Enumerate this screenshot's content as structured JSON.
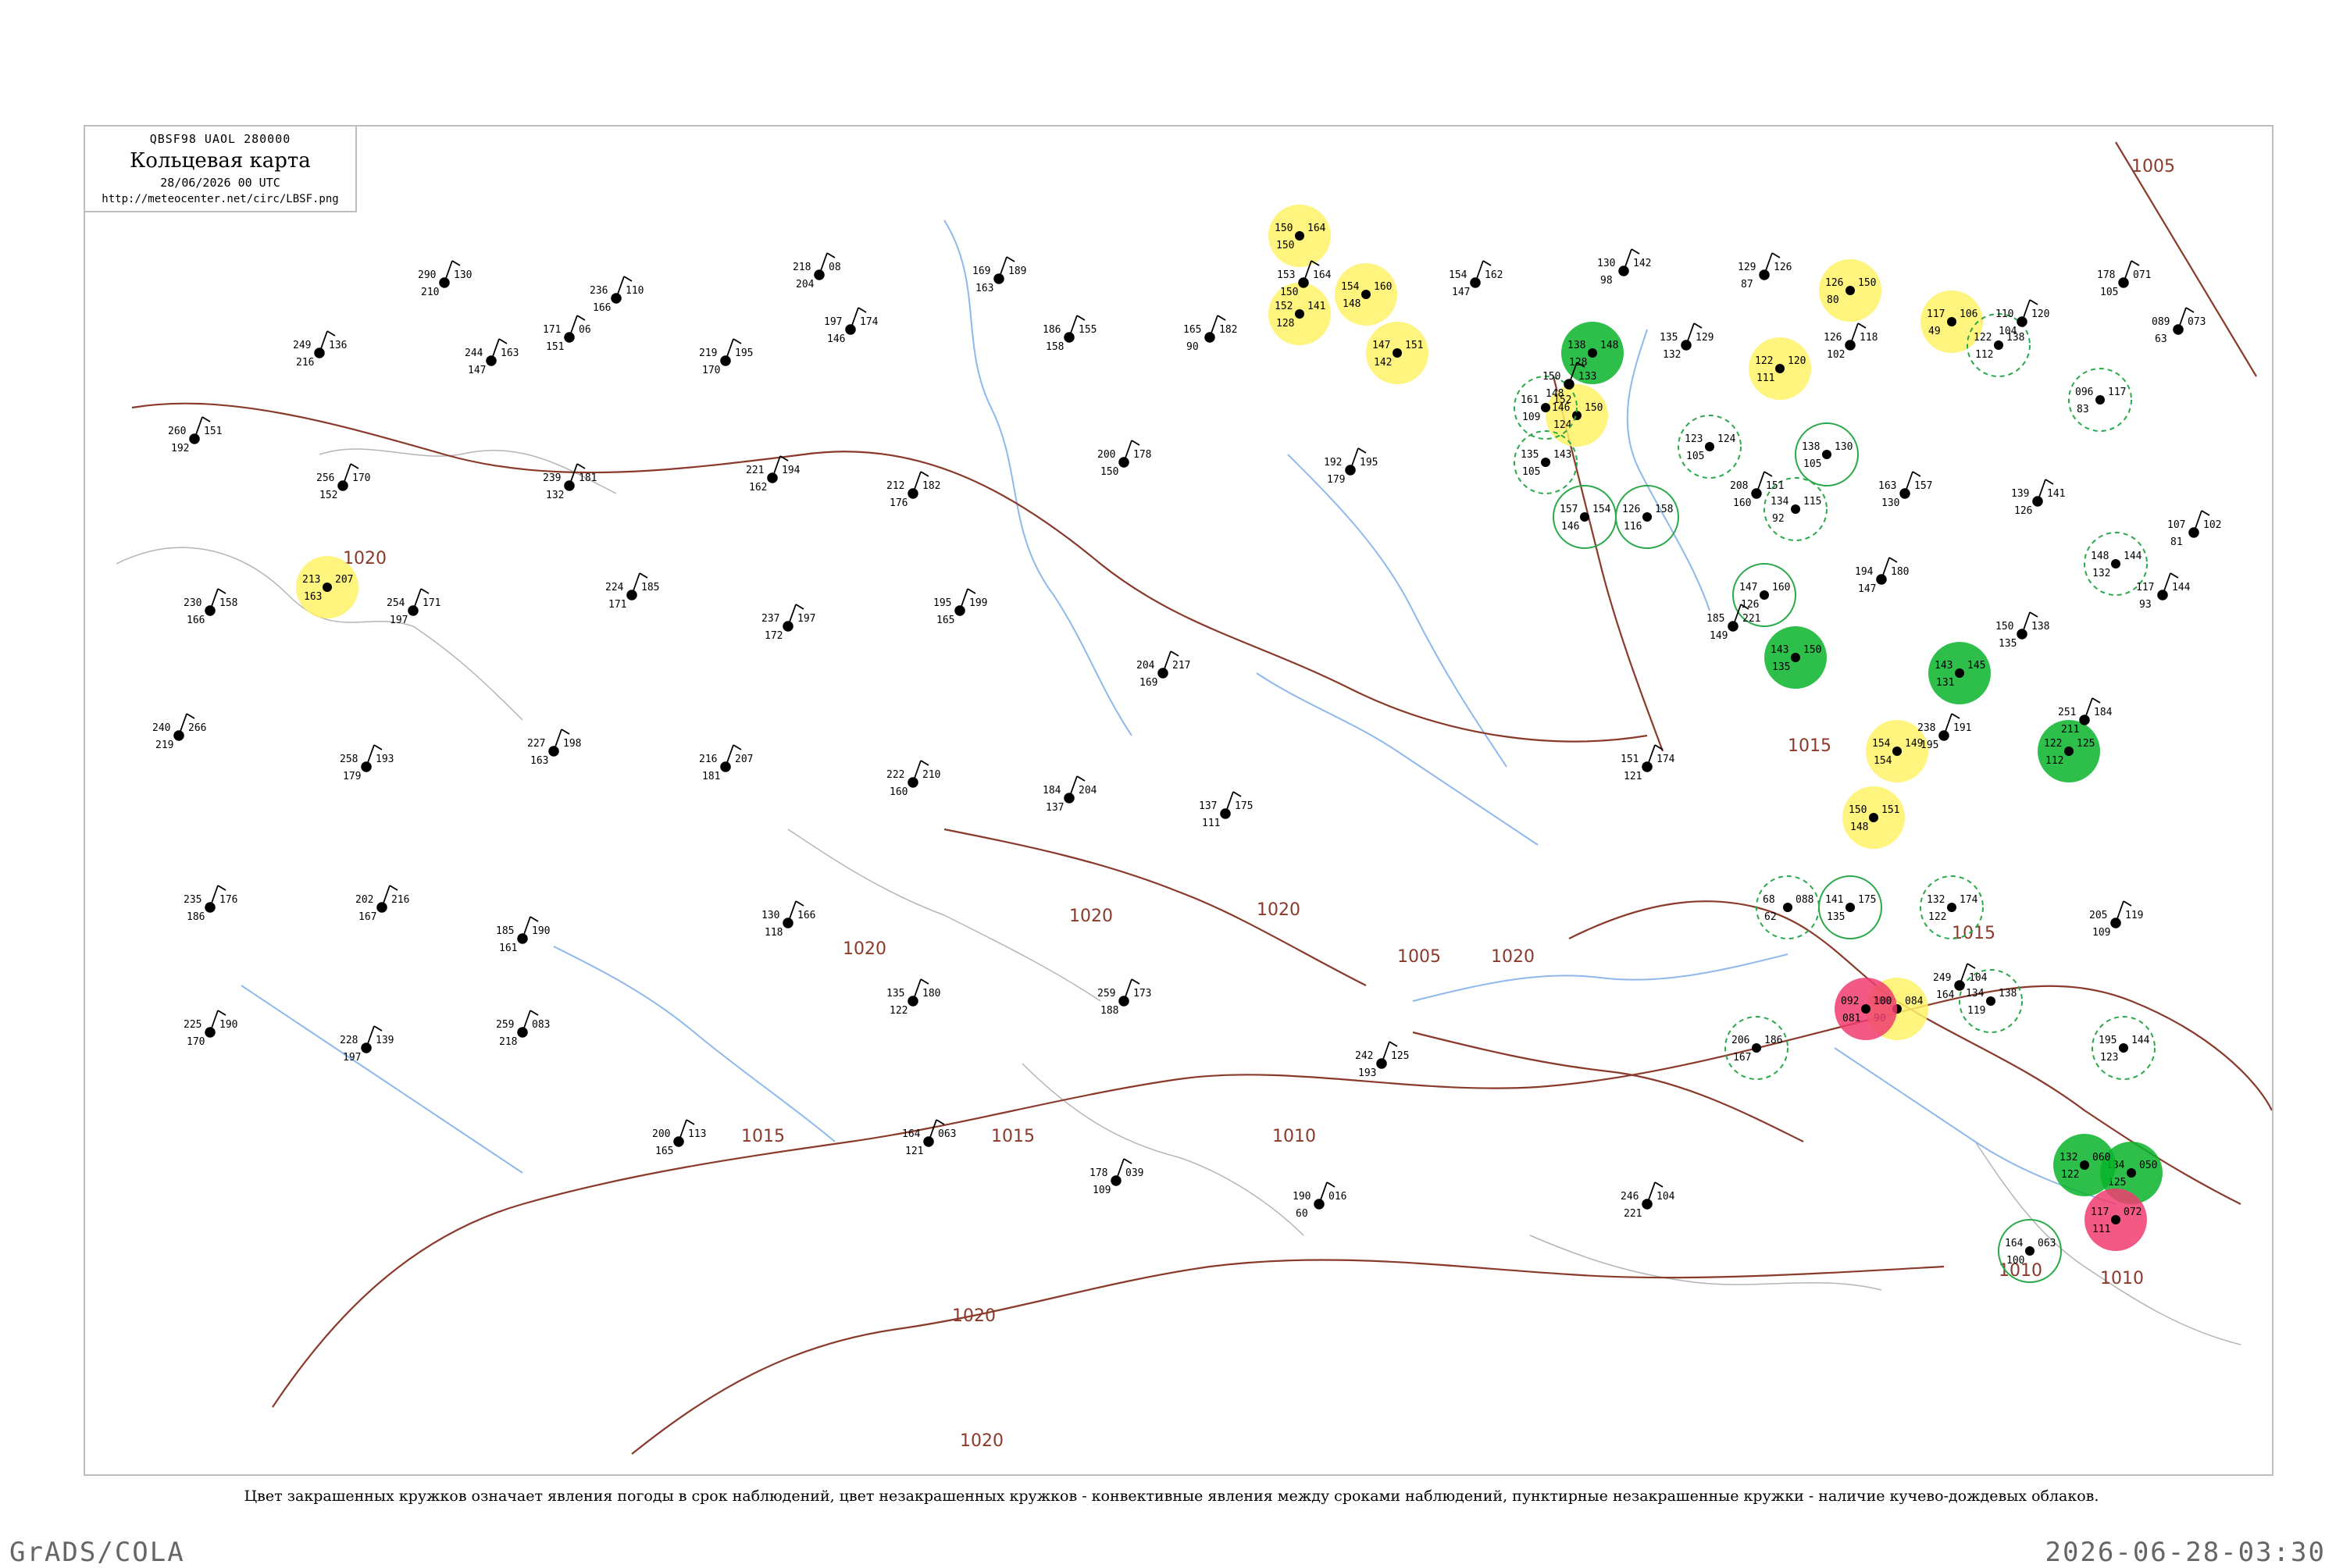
{
  "header": {
    "code_line": "QBSF98  UAOL  280000",
    "title": "Кольцевая карта",
    "datetime": "28/06/2026 00 UTC",
    "url": "http://meteocenter.net/circ/LBSF.png"
  },
  "legend_note": "Цвет закрашенных кружков означает явления погоды в срок наблюдений, цвет незакрашенных кружков - конвективные явления между сроками наблюдений, пунктирные незакрашенные кружки - наличие кучево-дождевых облаков.",
  "footer": {
    "left": "GrADS/COLA",
    "right": "2026-06-28-03:30"
  },
  "colors": {
    "isobar": "#8a3a2a",
    "river": "#8fb8ec",
    "coast": "#b5b5b5",
    "station": "#000000",
    "highlight_yellow": "#fff266",
    "highlight_green": "#08b42a",
    "highlight_red": "#f03c6e",
    "convective_ring_green": "#2aa84a"
  },
  "isobar_labels": [
    "1005",
    "1010",
    "1015",
    "1020"
  ],
  "stations": [
    {
      "t": "290",
      "d": "210",
      "p": "130"
    },
    {
      "t": "171",
      "d": "151",
      "p": "06"
    },
    {
      "t": "236",
      "d": "166",
      "p": "110"
    },
    {
      "t": "218",
      "d": "204",
      "p": "08"
    },
    {
      "t": "169",
      "d": "163",
      "p": "189"
    },
    {
      "t": "153",
      "d": "150",
      "p": "164"
    },
    {
      "t": "154",
      "d": "147",
      "p": "162"
    },
    {
      "t": "130",
      "d": "98",
      "p": "142"
    },
    {
      "t": "129",
      "d": "87",
      "p": "126"
    },
    {
      "t": "178",
      "d": "105",
      "p": "071"
    },
    {
      "t": "249",
      "d": "216",
      "p": "136"
    },
    {
      "t": "244",
      "d": "147",
      "p": "163"
    },
    {
      "t": "219",
      "d": "170",
      "p": "195"
    },
    {
      "t": "197",
      "d": "146",
      "p": "174"
    },
    {
      "t": "186",
      "d": "158",
      "p": "155"
    },
    {
      "t": "165",
      "d": "90",
      "p": "182"
    },
    {
      "t": "150",
      "d": "148",
      "p": "133"
    },
    {
      "t": "135",
      "d": "132",
      "p": "129"
    },
    {
      "t": "126",
      "d": "102",
      "p": "118"
    },
    {
      "t": "110",
      "d": "104",
      "p": "120"
    },
    {
      "t": "089",
      "d": "63",
      "p": "073"
    },
    {
      "t": "260",
      "d": "192",
      "p": "151"
    },
    {
      "t": "256",
      "d": "152",
      "p": "170"
    },
    {
      "t": "239",
      "d": "132",
      "p": "181"
    },
    {
      "t": "221",
      "d": "162",
      "p": "194"
    },
    {
      "t": "212",
      "d": "176",
      "p": "182"
    },
    {
      "t": "200",
      "d": "150",
      "p": "178"
    },
    {
      "t": "192",
      "d": "179",
      "p": "195"
    },
    {
      "t": "208",
      "d": "160",
      "p": "151"
    },
    {
      "t": "163",
      "d": "130",
      "p": "157"
    },
    {
      "t": "139",
      "d": "126",
      "p": "141"
    },
    {
      "t": "107",
      "d": "81",
      "p": "102"
    },
    {
      "t": "230",
      "d": "166",
      "p": "158"
    },
    {
      "t": "254",
      "d": "197",
      "p": "171"
    },
    {
      "t": "224",
      "d": "171",
      "p": "185"
    },
    {
      "t": "237",
      "d": "172",
      "p": "197"
    },
    {
      "t": "195",
      "d": "165",
      "p": "199"
    },
    {
      "t": "204",
      "d": "169",
      "p": "217"
    },
    {
      "t": "185",
      "d": "149",
      "p": "221"
    },
    {
      "t": "194",
      "d": "147",
      "p": "180"
    },
    {
      "t": "150",
      "d": "135",
      "p": "138"
    },
    {
      "t": "117",
      "d": "93",
      "p": "144"
    },
    {
      "t": "240",
      "d": "219",
      "p": "266"
    },
    {
      "t": "258",
      "d": "179",
      "p": "193"
    },
    {
      "t": "227",
      "d": "163",
      "p": "198"
    },
    {
      "t": "216",
      "d": "181",
      "p": "207"
    },
    {
      "t": "222",
      "d": "160",
      "p": "210"
    },
    {
      "t": "184",
      "d": "137",
      "p": "204"
    },
    {
      "t": "137",
      "d": "111",
      "p": "175"
    },
    {
      "t": "151",
      "d": "121",
      "p": "174"
    },
    {
      "t": "238",
      "d": "195",
      "p": "191"
    },
    {
      "t": "251",
      "d": "211",
      "p": "184"
    },
    {
      "t": "235",
      "d": "186",
      "p": "176"
    },
    {
      "t": "202",
      "d": "167",
      "p": "216"
    },
    {
      "t": "185",
      "d": "161",
      "p": "190"
    },
    {
      "t": "130",
      "d": "118",
      "p": "166"
    },
    {
      "t": "135",
      "d": "122",
      "p": "180"
    },
    {
      "t": "259",
      "d": "188",
      "p": "173"
    },
    {
      "t": "242",
      "d": "193",
      "p": "125"
    },
    {
      "t": "249",
      "d": "164",
      "p": "104"
    },
    {
      "t": "205",
      "d": "109",
      "p": "119"
    },
    {
      "t": "225",
      "d": "170",
      "p": "190"
    },
    {
      "t": "228",
      "d": "197",
      "p": "139"
    },
    {
      "t": "259",
      "d": "218",
      "p": "083"
    },
    {
      "t": "200",
      "d": "165",
      "p": "113"
    },
    {
      "t": "164",
      "d": "121",
      "p": "063"
    },
    {
      "t": "178",
      "d": "109",
      "p": "039"
    },
    {
      "t": "190",
      "d": "60",
      "p": "016"
    },
    {
      "t": "246",
      "d": "221",
      "p": "104"
    }
  ],
  "highlights": [
    {
      "kind": "yellow",
      "t": "150",
      "d": "150",
      "p": "164"
    },
    {
      "kind": "yellow",
      "t": "152",
      "d": "128",
      "p": "141"
    },
    {
      "kind": "yellow",
      "t": "154",
      "d": "148",
      "p": "160"
    },
    {
      "kind": "yellow",
      "t": "147",
      "d": "142",
      "p": "151"
    },
    {
      "kind": "yellow",
      "t": "213",
      "d": "163",
      "p": "207"
    },
    {
      "kind": "yellow",
      "t": "154",
      "d": "154",
      "p": "149"
    },
    {
      "kind": "yellow",
      "t": "150",
      "d": "148",
      "p": "151"
    },
    {
      "kind": "yellow",
      "t": "122",
      "d": "111",
      "p": "120"
    },
    {
      "kind": "yellow",
      "t": "117",
      "d": "49",
      "p": "106"
    },
    {
      "kind": "yellow",
      "t": "126",
      "d": "80",
      "p": "150"
    },
    {
      "kind": "yellow",
      "t": "146",
      "d": "124",
      "p": "150"
    },
    {
      "kind": "yellow",
      "t": "100",
      "d": "90",
      "p": "084"
    },
    {
      "kind": "green",
      "t": "138",
      "d": "128",
      "p": "148"
    },
    {
      "kind": "green",
      "t": "143",
      "d": "135",
      "p": "150"
    },
    {
      "kind": "green",
      "t": "143",
      "d": "131",
      "p": "145"
    },
    {
      "kind": "green",
      "t": "122",
      "d": "112",
      "p": "125"
    },
    {
      "kind": "green",
      "t": "134",
      "d": "125",
      "p": "050"
    },
    {
      "kind": "green",
      "t": "132",
      "d": "122",
      "p": "060"
    },
    {
      "kind": "red",
      "t": "092",
      "d": "081",
      "p": "100"
    },
    {
      "kind": "red",
      "t": "117",
      "d": "111",
      "p": "072"
    }
  ],
  "rings": [
    {
      "style": "dashed",
      "t": "161",
      "d": "109",
      "p": "152"
    },
    {
      "style": "dashed",
      "t": "135",
      "d": "105",
      "p": "143"
    },
    {
      "style": "solid",
      "t": "157",
      "d": "146",
      "p": "154"
    },
    {
      "style": "solid",
      "t": "126",
      "d": "116",
      "p": "158"
    },
    {
      "style": "dashed",
      "t": "123",
      "d": "105",
      "p": "124"
    },
    {
      "style": "solid",
      "t": "138",
      "d": "105",
      "p": "130"
    },
    {
      "style": "dashed",
      "t": "134",
      "d": "92",
      "p": "115"
    },
    {
      "style": "solid",
      "t": "147",
      "d": "126",
      "p": "160"
    },
    {
      "style": "dashed",
      "t": "206",
      "d": "167",
      "p": "186"
    },
    {
      "style": "dashed",
      "t": "68",
      "d": "62",
      "p": "088"
    },
    {
      "style": "solid",
      "t": "141",
      "d": "135",
      "p": "175"
    },
    {
      "style": "dashed",
      "t": "132",
      "d": "122",
      "p": "174"
    },
    {
      "style": "dashed",
      "t": "134",
      "d": "119",
      "p": "138"
    },
    {
      "style": "dashed",
      "t": "195",
      "d": "123",
      "p": "144"
    },
    {
      "style": "solid",
      "t": "164",
      "d": "100",
      "p": "063"
    },
    {
      "style": "dashed",
      "t": "148",
      "d": "132",
      "p": "144"
    },
    {
      "style": "dashed",
      "t": "122",
      "d": "112",
      "p": "138"
    },
    {
      "style": "dashed",
      "t": "096",
      "d": "83",
      "p": "117"
    }
  ]
}
